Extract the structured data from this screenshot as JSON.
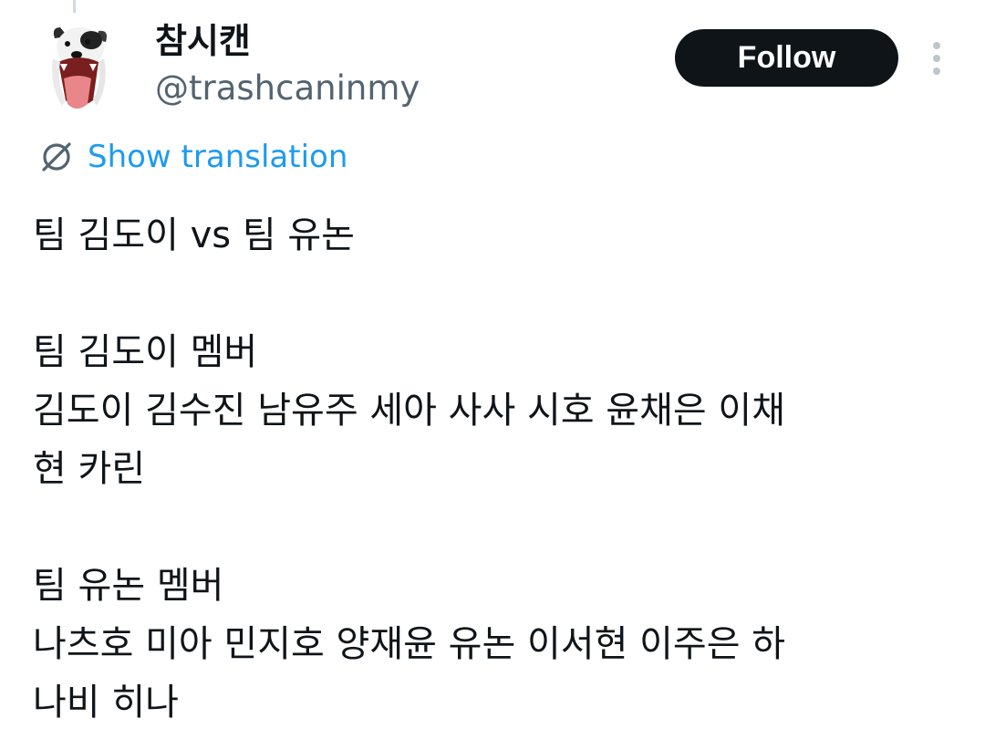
{
  "author": {
    "display_name": "참시캔",
    "handle": "@trashcaninmy",
    "avatar_icon": "dog-avatar"
  },
  "follow_label": "Follow",
  "more_icon": "more-vertical-icon",
  "translation": {
    "label": "Show translation",
    "icon": "translate-icon"
  },
  "tweet": {
    "lines": [
      "팀 김도이 vs 팀 유논",
      "",
      "팀 김도이 멤버",
      "김도이 김수진 남유주 세아 사사 시호 윤채은 이채",
      "현 카린",
      "",
      "팀 유논 멤버",
      "나츠호 미아 민지호 양재윤 유논 이서현 이주은 하",
      "나비 히나"
    ]
  },
  "colors": {
    "follow_bg": "#0f1419",
    "link": "#1d9bf0",
    "secondary_text": "#536471"
  }
}
